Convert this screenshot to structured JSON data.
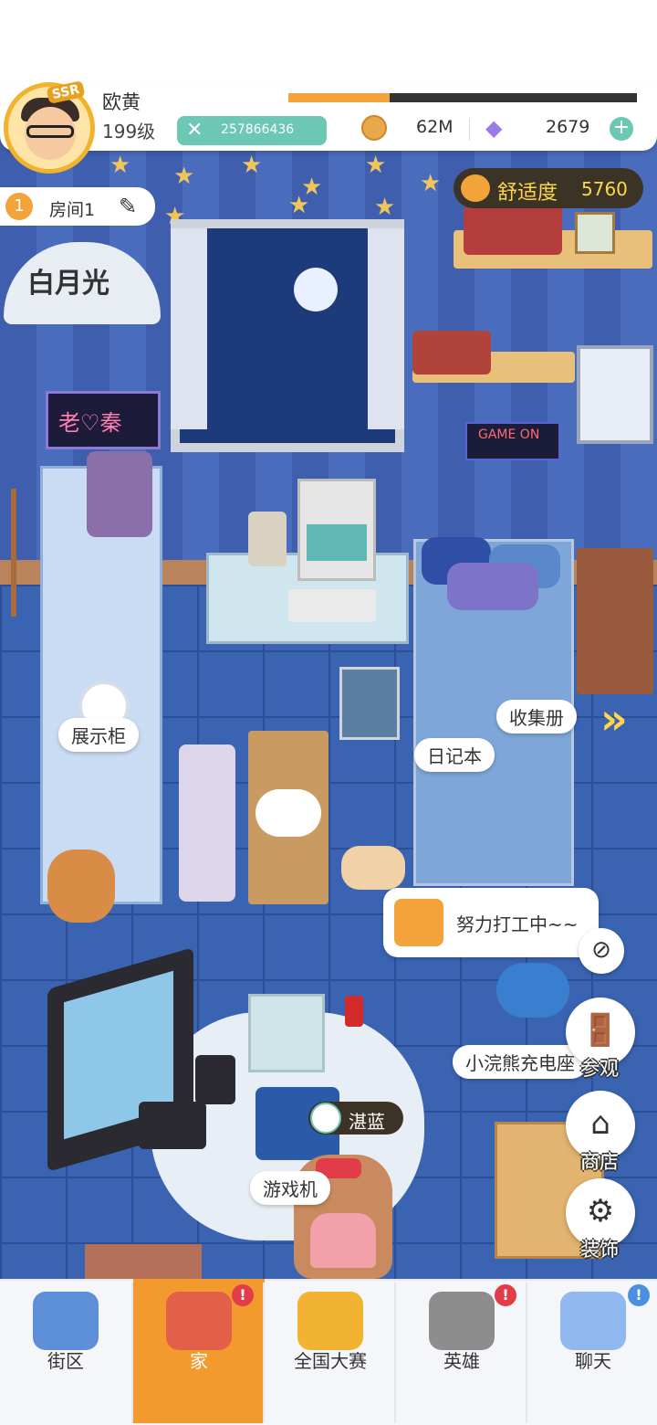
{
  "player": {
    "name": "欧黄",
    "level": "199级",
    "rank_badge": "SSR",
    "xp_fraction": 0.29,
    "power": "257866436",
    "coins": "62M",
    "gems": "2679",
    "plus_icon": "+"
  },
  "room": {
    "number": "1",
    "name": "房间1",
    "comfort_label": "舒适度",
    "comfort_value": "5760"
  },
  "decor_text": {
    "fan": "白月光",
    "neon_sign": "老♡秦",
    "game_sign": "GAME ON"
  },
  "labels": {
    "display_cabinet": "展示柜",
    "collection_book": "收集册",
    "diary": "日记本",
    "charger": "小浣熊充电座",
    "game_machine": "游戏机",
    "npc_name": "湛蓝"
  },
  "work_bubble": {
    "text": "努力打工中~~"
  },
  "side_actions": [
    {
      "label": "参观",
      "icon": "door-icon"
    },
    {
      "label": "商店",
      "icon": "shop-icon"
    },
    {
      "label": "装饰",
      "icon": "gear-icon"
    }
  ],
  "bottom_nav": [
    {
      "label": "街区",
      "icon": "signpost-icon",
      "active": false,
      "badge": ""
    },
    {
      "label": "家",
      "icon": "house-icon",
      "active": true,
      "badge": "!"
    },
    {
      "label": "全国大赛",
      "icon": "trophy-icon",
      "active": false,
      "badge": ""
    },
    {
      "label": "英雄",
      "icon": "cards-icon",
      "active": false,
      "badge": "!"
    },
    {
      "label": "聊天",
      "icon": "chat-icon",
      "active": false,
      "badge": "!"
    }
  ],
  "colors": {
    "accent": "#f39a2e",
    "teal": "#6cc7b4",
    "badge_red": "#e23c48",
    "badge_blue": "#4a90e2"
  }
}
